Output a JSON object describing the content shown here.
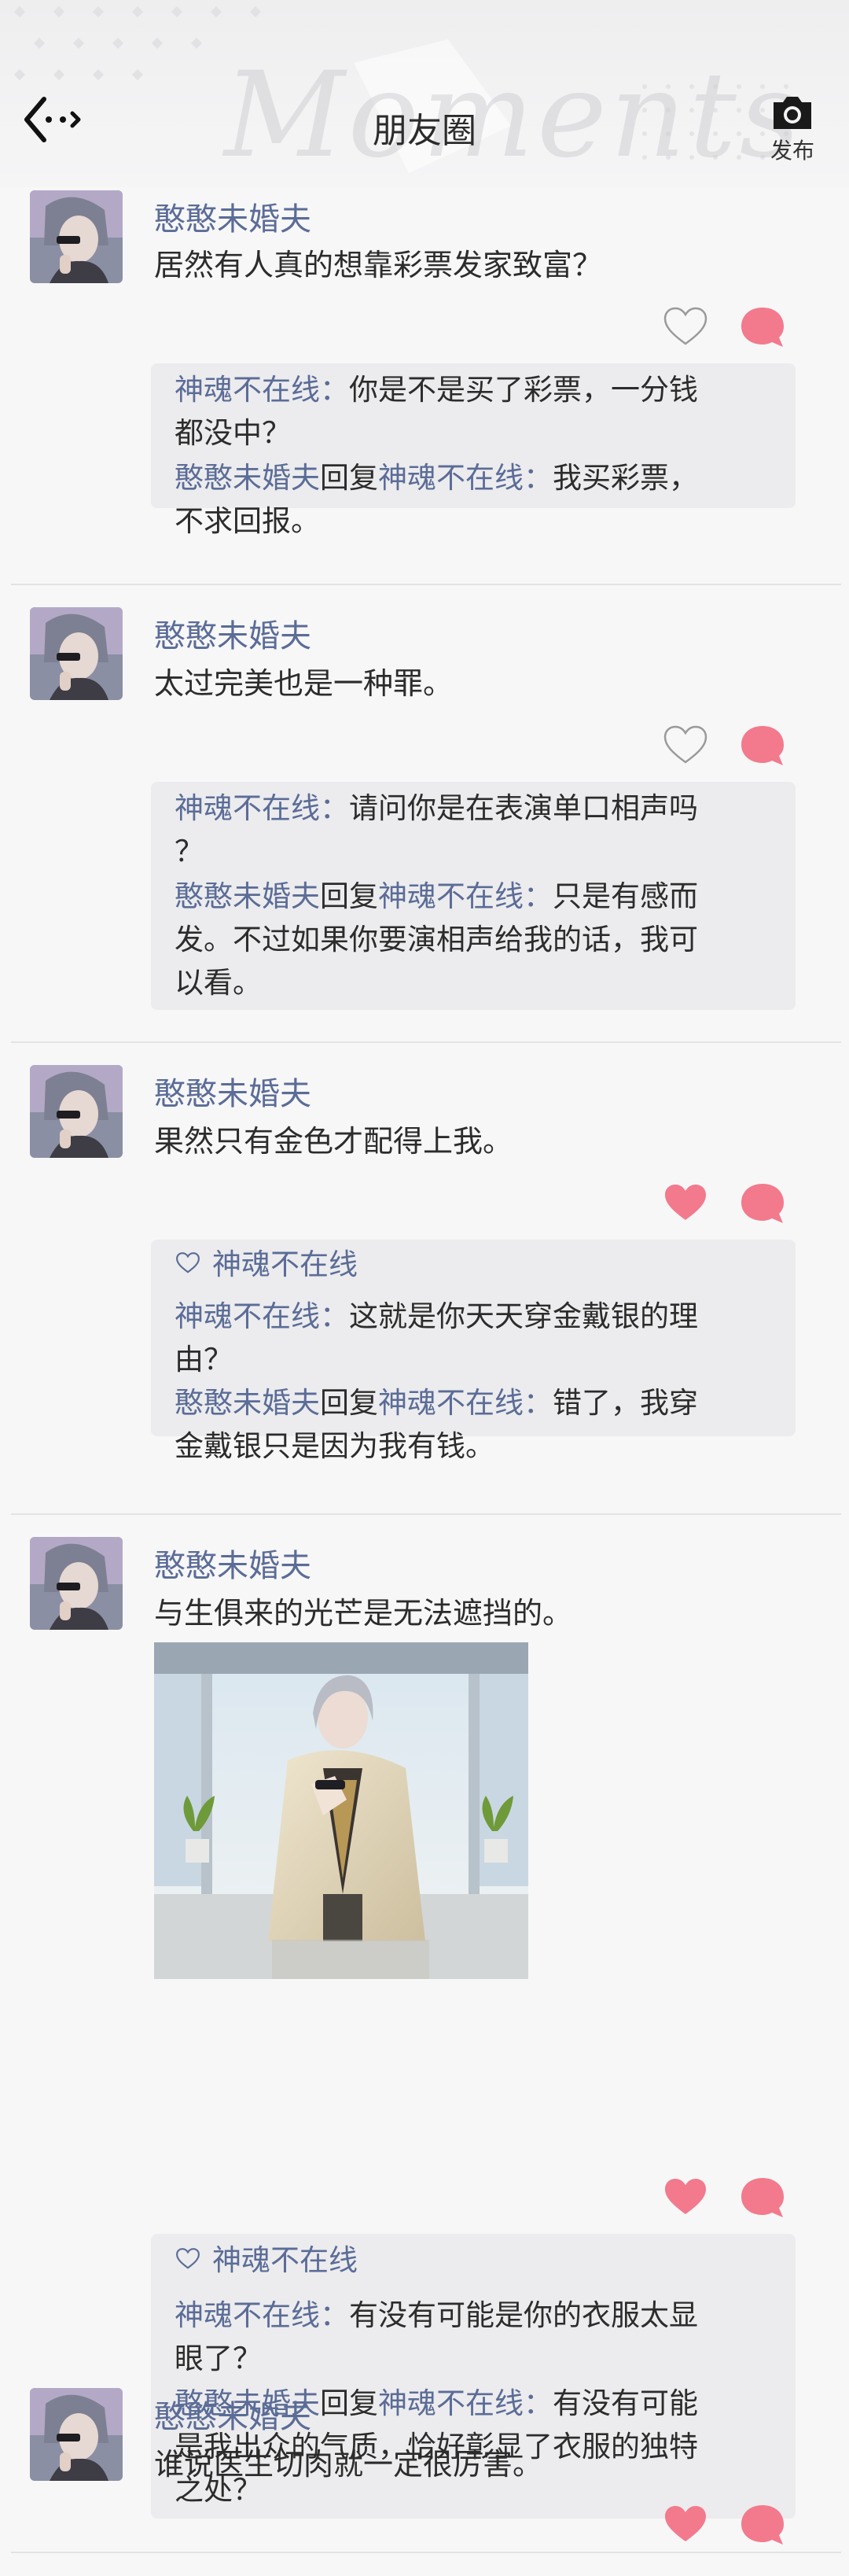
{
  "header": {
    "title": "朋友圈",
    "watermark": "Moments",
    "publish_label": "发布"
  },
  "posts": [
    {
      "author": "憨憨未婚夫",
      "text": "居然有人真的想靠彩票发家致富？",
      "liked": false,
      "likes": "",
      "comments": [
        {
          "from": "神魂不在线",
          "reply_word": "",
          "to": "",
          "text": "你是不是买了彩票，一分钱",
          "text2": "都没中？"
        },
        {
          "from": "憨憨未婚夫",
          "reply_word": "回复",
          "to": "神魂不在线",
          "text": "我买彩票，",
          "text2": "不求回报。"
        }
      ]
    },
    {
      "author": "憨憨未婚夫",
      "text": "太过完美也是一种罪。",
      "liked": false,
      "likes": "",
      "comments": [
        {
          "from": "神魂不在线",
          "reply_word": "",
          "to": "",
          "text": "请问你是在表演单口相声吗",
          "text2": "？"
        },
        {
          "from": "憨憨未婚夫",
          "reply_word": "回复",
          "to": "神魂不在线",
          "text": "只是有感而",
          "text2": "发。不过如果你要演相声给我的话，我可",
          "text3": "以看。"
        }
      ]
    },
    {
      "author": "憨憨未婚夫",
      "text": "果然只有金色才配得上我。",
      "liked": true,
      "likes": "神魂不在线",
      "comments": [
        {
          "from": "神魂不在线",
          "reply_word": "",
          "to": "",
          "text": "这就是你天天穿金戴银的理",
          "text2": "由？"
        },
        {
          "from": "憨憨未婚夫",
          "reply_word": "回复",
          "to": "神魂不在线",
          "text": "错了，我穿",
          "text2": "金戴银只是因为我有钱。"
        }
      ]
    },
    {
      "author": "憨憨未婚夫",
      "text": "与生俱来的光芒是无法遮挡的。",
      "liked": true,
      "likes": "神魂不在线",
      "comments": [
        {
          "from": "神魂不在线",
          "reply_word": "",
          "to": "",
          "text": "有没有可能是你的衣服太显",
          "text2": "眼了？"
        },
        {
          "from": "憨憨未婚夫",
          "reply_word": "回复",
          "to": "神魂不在线",
          "text": "有没有可能",
          "text2": "是我出众的气质，恰好彰显了衣服的独特",
          "text3": "之处？"
        }
      ]
    },
    {
      "author": "憨憨未婚夫",
      "text": "谁说医生切肉就一定很厉害。",
      "liked": true,
      "likes": "",
      "comments": []
    }
  ],
  "colors": {
    "name_blue": "#5b6c97",
    "heart_pink": "#f27a8c",
    "comment_bg": "#ececee"
  },
  "icons": {
    "back": "back-arrow-icon",
    "camera": "camera-icon",
    "like": "heart-icon",
    "comment": "comment-bubble-icon"
  }
}
